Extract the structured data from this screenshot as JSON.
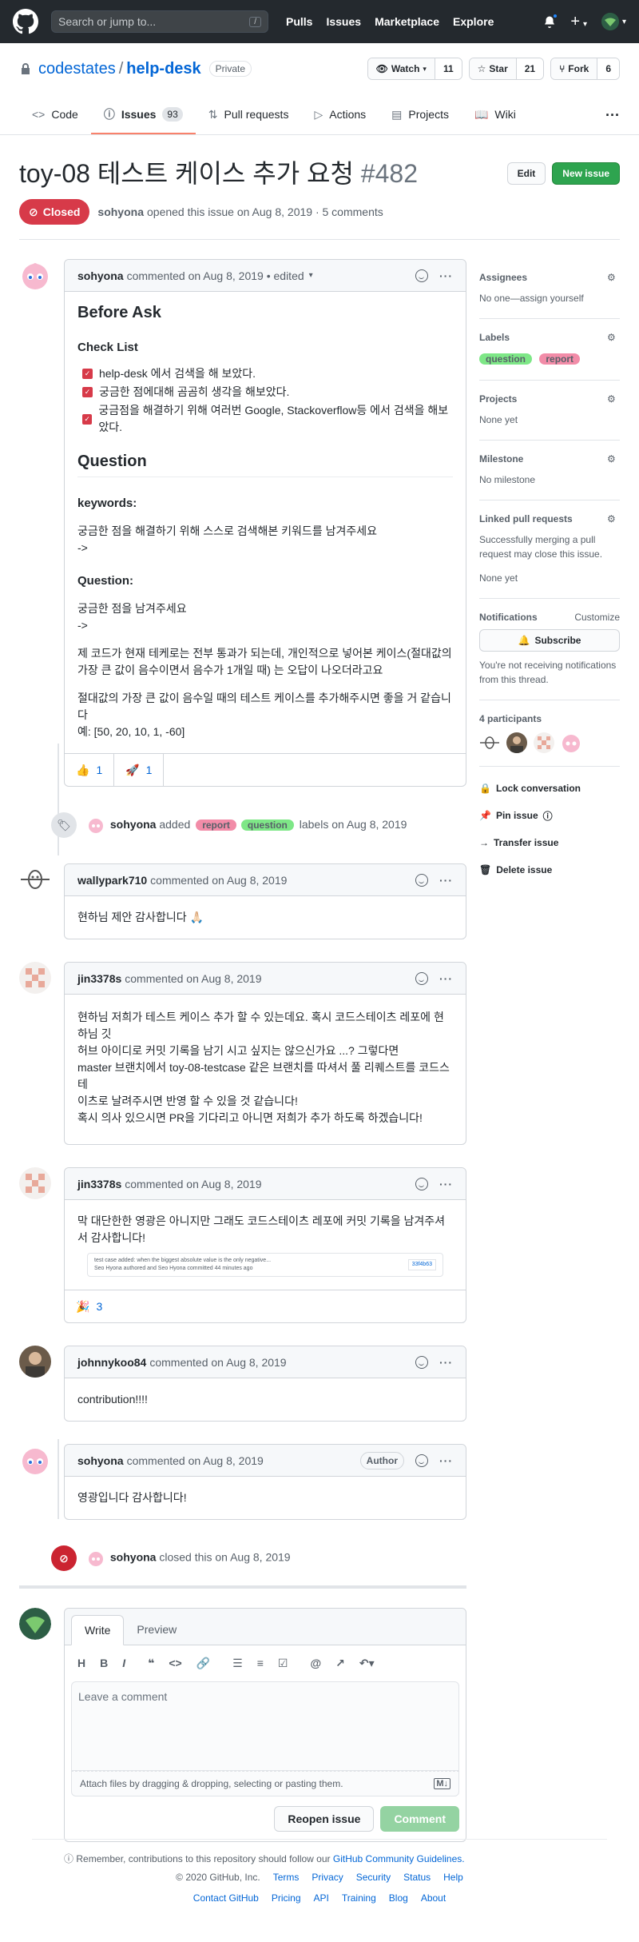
{
  "topbar": {
    "search_placeholder": "Search or jump to...",
    "search_key": "/",
    "nav": [
      "Pulls",
      "Issues",
      "Marketplace",
      "Explore"
    ]
  },
  "repo": {
    "owner": "codestates",
    "separator": "/",
    "name": "help-desk",
    "visibility": "Private",
    "watch_label": "Watch",
    "watch_count": "11",
    "star_label": "Star",
    "star_count": "21",
    "fork_label": "Fork",
    "fork_count": "6"
  },
  "tabs": [
    {
      "label": "Code"
    },
    {
      "label": "Issues",
      "count": "93"
    },
    {
      "label": "Pull requests"
    },
    {
      "label": "Actions"
    },
    {
      "label": "Projects"
    },
    {
      "label": "Wiki"
    }
  ],
  "issue": {
    "title": "toy-08 테스트 케이스 추가 요청",
    "number": "#482",
    "edit_label": "Edit",
    "new_issue_label": "New issue",
    "state": "Closed",
    "author": "sohyona",
    "meta": "opened this issue on Aug 8, 2019 · 5 comments"
  },
  "comments": [
    {
      "author": "sohyona",
      "meta": "commented on Aug 8, 2019 • edited",
      "before_ask": "Before Ask",
      "checklist_title": "Check List",
      "checklist": [
        "help-desk 에서 검색을 해 보았다.",
        "궁금한 점에대해 곰곰히 생각을 해보았다.",
        "궁금점을 해결하기 위해 여러번 Google, Stackoverflow등 에서 검색을 해보았다."
      ],
      "question_heading": "Question",
      "keywords_label": "keywords:",
      "keywords_text": "궁금한 점을 해결하기 위해 스스로 검색해본 키워드를 남겨주세요",
      "arrow1": "->",
      "question_label": "Question:",
      "question_text": "궁금한 점을 남겨주세요",
      "arrow2": "->",
      "para1": "제 코드가 현재 테케로는 전부 통과가 되는데, 개인적으로 넣어본 케이스(절대값의 가장 큰 값이 음수이면서 음수가 1개일 때) 는 오답이 나오더라고요",
      "para2": "절대값의 가장 큰 값이 음수일 때의 테스트 케이스를 추가해주시면 좋을 거 같습니다",
      "para3": "예: [50, 20, 10, 1, -60]",
      "reactions": [
        {
          "emoji": "👍",
          "count": "1"
        },
        {
          "emoji": "🚀",
          "count": "1"
        }
      ]
    },
    {
      "author": "wallypark710",
      "meta": "commented on Aug 8, 2019",
      "body": "현하님 제안 감사합니다 🙏🏻"
    },
    {
      "author": "jin3378s",
      "meta": "commented on Aug 8, 2019",
      "body": [
        "현하님 저희가 테스트 케이스 추가 할 수 있는데요. 혹시 코드스테이츠 레포에 현하님 깃",
        "허브 아이디로 커밋 기록을 남기 시고 싶지는 않으신가요 ...? 그렇다면",
        "master 브랜치에서 toy-08-testcase 같은 브랜치를 따셔서 풀 리퀘스트를 코드스테",
        "이츠로 날려주시면 반영 할 수 있을 것 같습니다!",
        "혹시 의사 있으시면 PR을 기다리고 아니면 저희가 추가 하도록 하겠습니다!"
      ]
    },
    {
      "author": "jin3378s",
      "meta": "commented on Aug 8, 2019",
      "body": "막 대단한한 영광은 아니지만 그래도 코드스테이츠 레포에 커밋 기록을 남겨주셔서 감사합니다!",
      "commit_title": "test case added: when the biggest absolute value is the only negative...",
      "commit_meta": "Seo Hyona authored and Seo Hyona committed 44 minutes ago",
      "commit_sha": "33f4b63",
      "reactions": [
        {
          "emoji": "🎉",
          "count": "3"
        }
      ]
    },
    {
      "author": "johnnykoo84",
      "meta": "commented on Aug 8, 2019",
      "body": "contribution!!!!"
    },
    {
      "author": "sohyona",
      "meta": "commented on Aug 8, 2019",
      "badge": "Author",
      "body": "영광입니다 감사합니다!"
    }
  ],
  "events": {
    "labeled": {
      "actor": "sohyona",
      "verb": "added",
      "suffix": "labels on Aug 8, 2019"
    },
    "closed": {
      "actor": "sohyona",
      "text": "closed this on Aug 8, 2019"
    }
  },
  "composer": {
    "write_tab": "Write",
    "preview_tab": "Preview",
    "placeholder": "Leave a comment",
    "attach_text": "Attach files by dragging & dropping, selecting or pasting them.",
    "reopen_label": "Reopen issue",
    "comment_label": "Comment",
    "guidelines_prefix": "Remember, contributions to this repository should follow our",
    "guidelines_link": "GitHub Community Guidelines."
  },
  "sidebar": {
    "assignees_title": "Assignees",
    "assignees_value": "No one—assign yourself",
    "labels_title": "Labels",
    "labels": [
      {
        "name": "question",
        "color": "#7ee787"
      },
      {
        "name": "report",
        "color": "#f28ca8"
      }
    ],
    "projects_title": "Projects",
    "projects_value": "None yet",
    "milestone_title": "Milestone",
    "milestone_value": "No milestone",
    "linked_title": "Linked pull requests",
    "linked_desc": "Successfully merging a pull request may close this issue.",
    "linked_value": "None yet",
    "notifications_title": "Notifications",
    "customize": "Customize",
    "subscribe_label": "Subscribe",
    "notif_desc": "You're not receiving notifications from this thread.",
    "participants_title": "4 participants",
    "lock": "Lock conversation",
    "pin": "Pin issue",
    "transfer": "Transfer issue",
    "delete": "Delete issue"
  },
  "footer": {
    "copyright": "© 2020 GitHub, Inc.",
    "links_row1": [
      "Terms",
      "Privacy",
      "Security",
      "Status",
      "Help"
    ],
    "links_row2": [
      "Contact GitHub",
      "Pricing",
      "API",
      "Training",
      "Blog",
      "About"
    ]
  }
}
